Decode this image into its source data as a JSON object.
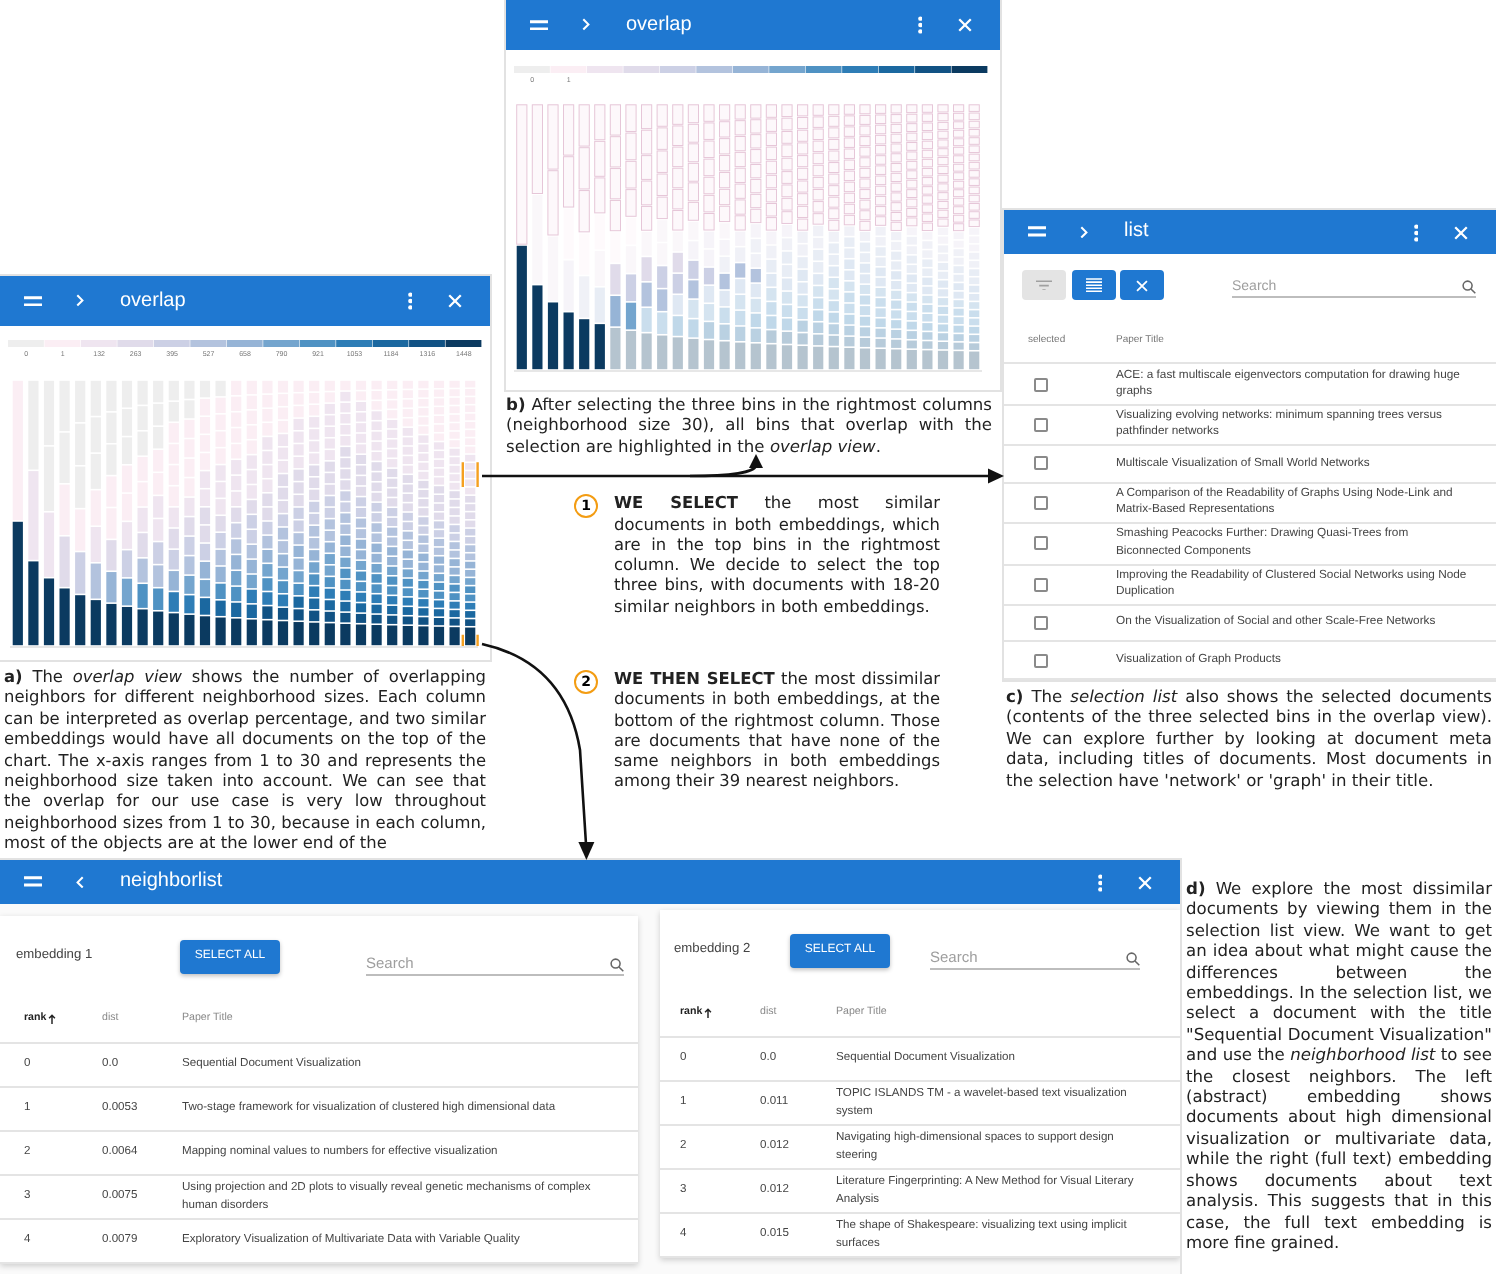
{
  "overlap_view_a": {
    "window_title": "overlap",
    "legend_labels": [
      "0",
      "1",
      "132",
      "263",
      "395",
      "527",
      "658",
      "790",
      "921",
      "1053",
      "1184",
      "1316",
      "1448"
    ],
    "highlighted": false,
    "selection_brackets": true
  },
  "caption_a": "**a)** The *overlap view* shows the number of overlapping neighbors for different neighborhood sizes. Each column can be interpreted as overlap percentage, and two similar embeddings would have all documents on the top of the chart. The x-axis ranges from 1 to 30 and represents the neighborhood size taken into account. We can see that the overlap for our use case is very low throughout neighborhood sizes from 1 to 30, because in each column, most of the objects are at the lower end of the",
  "overlap_view_b": {
    "window_title": "overlap",
    "legend_labels": [
      "0",
      "1"
    ],
    "highlighted": true,
    "selection_brackets": false
  },
  "caption_b": "**b)** After selecting the three bins in the rightmost columns (neighborhood size 30), all bins that overlap with the selection are highlighted in the *overlap view*.",
  "steps": [
    {
      "number": "1",
      "text": "**WE SELECT** the most similar documents in both embeddings, which are in the top bins in the rightmost column. We decide to select the top three bins, with documents with 18-20 similar neighbors in both embeddings."
    },
    {
      "number": "2",
      "text": "**WE THEN SELECT** the most dissimilar documents in both embeddings, at the bottom of the rightmost column. Those are documents that have none of the same neighbors in both embeddings among their 39 nearest neighbors."
    }
  ],
  "selection_list": {
    "window_title": "list",
    "toolbar": [
      {
        "kind": "filter",
        "disabled": true
      },
      {
        "kind": "list",
        "disabled": false
      },
      {
        "kind": "clear",
        "disabled": false
      }
    ],
    "search": {
      "placeholder": "Search"
    },
    "columns": [
      "selected",
      "Paper Title"
    ],
    "rows": [
      {
        "checked": false,
        "title": "ACE: a fast multiscale eigenvectors computation for drawing huge graphs"
      },
      {
        "checked": false,
        "title": "Visualizing evolving networks: minimum spanning trees versus pathfinder networks"
      },
      {
        "checked": false,
        "title": "Multiscale Visualization of Small World Networks"
      },
      {
        "checked": false,
        "title": "A Comparison of the Readability of Graphs Using Node-Link and Matrix-Based Representations"
      },
      {
        "checked": false,
        "title": "Smashing Peacocks Further: Drawing Quasi-Trees from Biconnected Components"
      },
      {
        "checked": false,
        "title": "Improving the Readability of Clustered Social Networks using Node Duplication"
      },
      {
        "checked": false,
        "title": "On the Visualization of Social and other Scale-Free Networks"
      },
      {
        "checked": false,
        "title": "Visualization of Graph Products"
      }
    ]
  },
  "caption_c": "**c)** The *selection list* also shows the selected documents (contents of the three selected bins in the overlap view). We can explore further by looking at document meta data, including titles of documents. Most documents in the selection have 'network' or 'graph' in their title.",
  "neighbor_list": {
    "window_title": "neighborlist",
    "embeddings": [
      {
        "label": "embedding 1",
        "button": "SELECT ALL",
        "search": {
          "placeholder": "Search"
        },
        "columns": [
          {
            "label": "rank",
            "sorted": true
          },
          {
            "label": "dist",
            "sorted": false
          },
          {
            "label": "Paper Title",
            "sorted": false
          }
        ],
        "rows": [
          {
            "rank": "0",
            "dist": "0.0",
            "title": "Sequential Document Visualization"
          },
          {
            "rank": "1",
            "dist": "0.0053",
            "title": "Two-stage framework for visualization of clustered high dimensional data"
          },
          {
            "rank": "2",
            "dist": "0.0064",
            "title": "Mapping nominal values to numbers for effective visualization"
          },
          {
            "rank": "3",
            "dist": "0.0075",
            "title": "Using projection and 2D plots to visually reveal genetic mechanisms of complex human disorders"
          },
          {
            "rank": "4",
            "dist": "0.0079",
            "title": "Exploratory Visualization of Multivariate Data with Variable Quality"
          }
        ]
      },
      {
        "label": "embedding 2",
        "button": "SELECT ALL",
        "search": {
          "placeholder": "Search"
        },
        "columns": [
          {
            "label": "rank",
            "sorted": true
          },
          {
            "label": "dist",
            "sorted": false
          },
          {
            "label": "Paper Title",
            "sorted": false
          }
        ],
        "rows": [
          {
            "rank": "0",
            "dist": "0.0",
            "title": "Sequential Document Visualization"
          },
          {
            "rank": "1",
            "dist": "0.011",
            "title": "TOPIC ISLANDS TM - a wavelet-based text visualization system"
          },
          {
            "rank": "2",
            "dist": "0.012",
            "title": "Navigating high-dimensional spaces to support design steering"
          },
          {
            "rank": "3",
            "dist": "0.012",
            "title": "Literature Fingerprinting: A New Method for Visual Literary Analysis"
          },
          {
            "rank": "4",
            "dist": "0.015",
            "title": "The shape of Shakespeare: visualizing text using implicit surfaces"
          }
        ]
      }
    ]
  },
  "caption_d": "**d)** We explore the most dissimilar documents by viewing them in the selection list view. We want to get an idea about what might cause the differences between the embeddings. In the selection list, we select a document with the title \"Sequential Document Visualization\" and use the *neighborhood list* to see the closest neighbors. The left (abstract) embedding shows documents about high dimensional visualization or multivariate data, while the right (full text) embedding shows documents about text analysis. This suggests that in this case, the full text embedding is more fine grained."
}
